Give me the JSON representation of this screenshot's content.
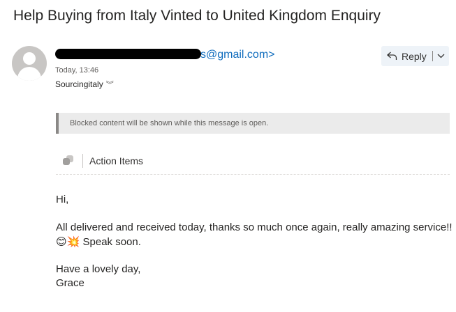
{
  "message": {
    "subject": "Help Buying from Italy Vinted to United Kingdom Enquiry",
    "sender_email_visible": "s@gmail.com>",
    "timestamp": "Today, 13:46",
    "recipient": "Sourcingitaly",
    "recipient_expand_icon": "double-chevron-down-icon"
  },
  "toolbar": {
    "reply_label": "Reply",
    "reply_icon": "reply-arrow-icon",
    "more_icon": "chevron-down-icon"
  },
  "banner": {
    "blocked_text": "Blocked content will be shown while this message is open."
  },
  "action_items": {
    "label": "Action Items",
    "icon": "action-items-icon"
  },
  "body": {
    "greeting": "Hi,",
    "line1": "All delivered and received today, thanks so much once again, really amazing service!!",
    "emoji1": "😊",
    "emoji2": "💥",
    "line2": "Speak soon.",
    "closing": "Have a lovely day,",
    "signature": "Grace"
  },
  "colors": {
    "link": "#0f6cbd",
    "text": "#252423",
    "banner_bg": "#ebebeb",
    "reply_bg": "#eef3f8"
  }
}
